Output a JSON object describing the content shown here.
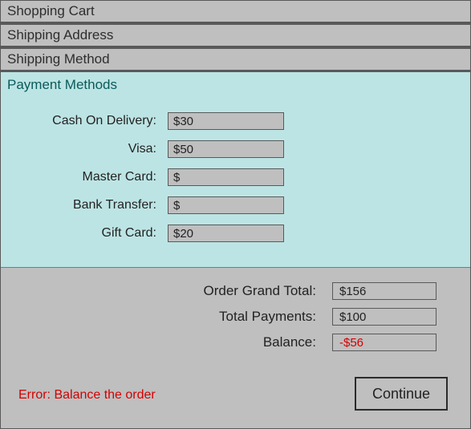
{
  "sections": {
    "cart": "Shopping Cart",
    "address": "Shipping Address",
    "method": "Shipping Method",
    "payment_title": "Payment Methods"
  },
  "payments": {
    "cod": {
      "label": "Cash On Delivery:",
      "value": "$30"
    },
    "visa": {
      "label": "Visa:",
      "value": "$50"
    },
    "mc": {
      "label": "Master Card:",
      "value": "$"
    },
    "bank": {
      "label": "Bank Transfer:",
      "value": "$"
    },
    "gift": {
      "label": "Gift Card:",
      "value": "$20"
    }
  },
  "totals": {
    "grand": {
      "label": "Order Grand Total:",
      "value": "$156"
    },
    "paid": {
      "label": "Total Payments:",
      "value": "$100"
    },
    "balance": {
      "label": "Balance:",
      "value": "-$56"
    }
  },
  "error": "Error: Balance the order",
  "continue_label": "Continue"
}
